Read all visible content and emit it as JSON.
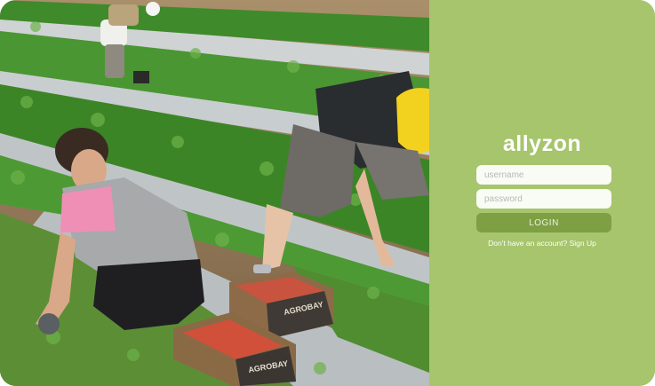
{
  "brand": {
    "name": "allyzon"
  },
  "login_form": {
    "username_placeholder": "username",
    "password_placeholder": "password",
    "login_label": "LOGIN",
    "signup_prompt": "Don't have an account?",
    "signup_link": "Sign Up"
  },
  "photo": {
    "crate_text": "AGROBAY"
  },
  "colors": {
    "panel": "#a6c56c",
    "button": "#7f9f45",
    "field_bg": "#f9fbf5"
  }
}
